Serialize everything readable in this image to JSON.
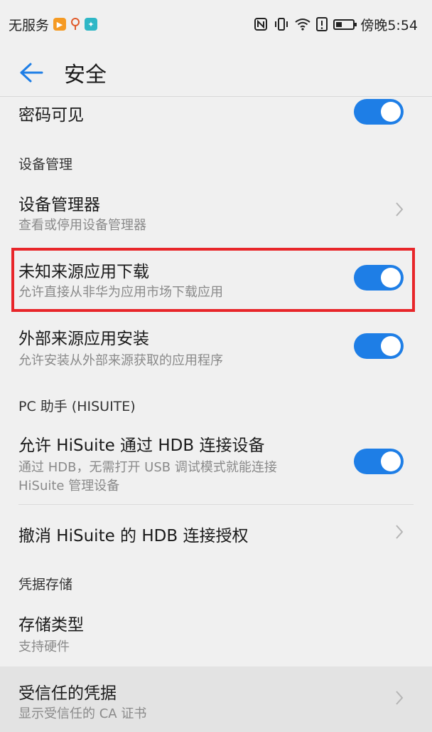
{
  "status_bar": {
    "left_text": "无服务",
    "time": "傍晚5:54",
    "icons": [
      "notification-orange-icon",
      "location-pin-icon",
      "app-teal-icon",
      "nfc-icon",
      "vibrate-icon",
      "wifi-icon",
      "alert-icon",
      "battery-icon"
    ]
  },
  "header": {
    "title": "安全"
  },
  "rows": {
    "password_visible": {
      "title": "密码可见",
      "toggle_on": true
    },
    "device_admin": {
      "title": "设备管理器",
      "subtitle": "查看或停用设备管理器"
    },
    "unknown_sources": {
      "title": "未知来源应用下载",
      "subtitle": "允许直接从非华为应用市场下载应用",
      "toggle_on": true
    },
    "external_sources": {
      "title": "外部来源应用安装",
      "subtitle": "允许安装从外部来源获取的应用程序",
      "toggle_on": true
    },
    "hisuite_allow": {
      "title": "允许 HiSuite 通过 HDB 连接设备",
      "subtitle_line1": "通过 HDB，无需打开 USB 调试模式就能连接",
      "subtitle_line2": "HiSuite 管理设备",
      "toggle_on": true
    },
    "hisuite_revoke": {
      "title": "撤消 HiSuite 的 HDB 连接授权"
    },
    "storage_type": {
      "title": "存储类型",
      "subtitle": "支持硬件"
    },
    "trusted_credentials": {
      "title": "受信任的凭据",
      "subtitle": "显示受信任的 CA 证书"
    }
  },
  "sections": {
    "device_management": "设备管理",
    "pc_assistant": "PC 助手 (HISUITE)",
    "credential_storage": "凭据存储"
  },
  "colors": {
    "toggle_on": "#1e7ee6",
    "accent_back": "#1e7ee6",
    "highlight": "#e8262a",
    "background": "#f0f0f0"
  }
}
